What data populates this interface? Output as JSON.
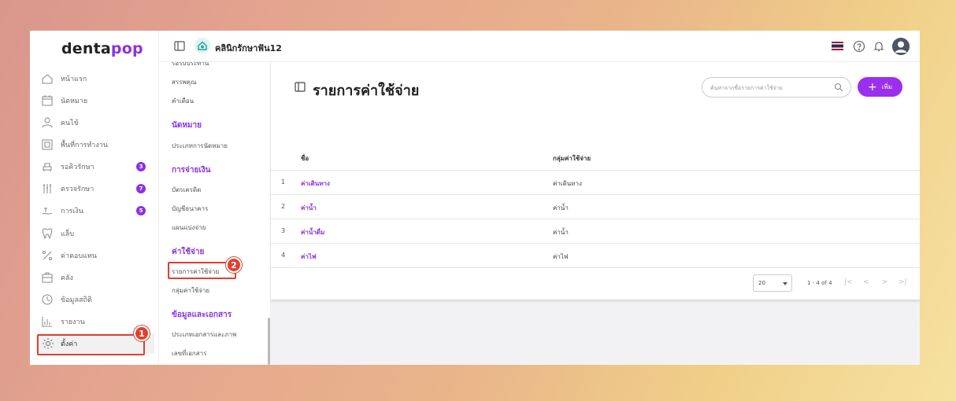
{
  "app": {
    "logo_left": "denta",
    "logo_right": "pop",
    "clinic_name": "คลินิกรักษาฟัน12"
  },
  "sidebar": {
    "items": [
      {
        "label": "หน้าแรก",
        "icon": "home-icon"
      },
      {
        "label": "นัดหมาย",
        "icon": "calendar-icon"
      },
      {
        "label": "คนไข้",
        "icon": "user-icon"
      },
      {
        "label": "พื้นที่การทำงาน",
        "icon": "workspace-icon"
      },
      {
        "label": "รอคิวรักษา",
        "icon": "chair-icon",
        "badge": "3"
      },
      {
        "label": "ตรวจรักษา",
        "icon": "tools-icon",
        "badge": "7"
      },
      {
        "label": "การเงิน",
        "icon": "money-icon",
        "badge": "5"
      },
      {
        "label": "แล็บ",
        "icon": "tooth-icon"
      },
      {
        "label": "ค่าตอบแทน",
        "icon": "percent-icon"
      },
      {
        "label": "คลัง",
        "icon": "storage-icon"
      },
      {
        "label": "ข้อมูลสถิติ",
        "icon": "stats-icon"
      },
      {
        "label": "รายงาน",
        "icon": "report-icon"
      },
      {
        "label": "ตั้งค่า",
        "icon": "gear-icon"
      }
    ]
  },
  "submenu": {
    "top_cut": "รอรับประทาน",
    "item_a": "สรรพคุณ",
    "item_b": "คำเตือน",
    "head_appointment": "นัดหมาย",
    "appointment_type": "ประเภทการนัดหมาย",
    "head_payment": "การจ่ายเงิน",
    "credit_card": "บัตรเครดิต",
    "bank_account": "บัญชีธนาคาร",
    "installment": "แผนแบ่งจ่าย",
    "head_expense": "ค่าใช้จ่าย",
    "expense_list": "รายการค่าใช้จ่าย",
    "expense_group": "กลุ่มค่าใช้จ่าย",
    "head_documents": "ข้อมูลและเอกสาร",
    "doc_types": "ประเภทเอกสารและภาพ",
    "doc_numbers": "เลขที่เอกสาร"
  },
  "main": {
    "title": "รายการค่าใช้จ่าย",
    "search_placeholder": "ค้นหาจากชื่อรายการค่าใช้จ่าย",
    "add_label": "เพิ่ม",
    "columns": {
      "name": "ชื่อ",
      "group": "กลุ่มค่าใช้จ่าย"
    },
    "rows": [
      {
        "num": "1",
        "name": "ค่าเดินทาง",
        "group": "ค่าเดินทาง"
      },
      {
        "num": "2",
        "name": "ค่าน้ำ",
        "group": "ค่าน้ำ"
      },
      {
        "num": "3",
        "name": "ค่าน้ำดื่ม",
        "group": "ค่าน้ำ"
      },
      {
        "num": "4",
        "name": "ค่าไฟ",
        "group": "ค่าไฟ"
      }
    ],
    "page_size": "20",
    "page_info": "1 - 4 of 4"
  },
  "annotations": {
    "step1": "1",
    "step2": "2"
  },
  "colors": {
    "accent": "#8b32e0",
    "annotation": "#e0402f"
  }
}
